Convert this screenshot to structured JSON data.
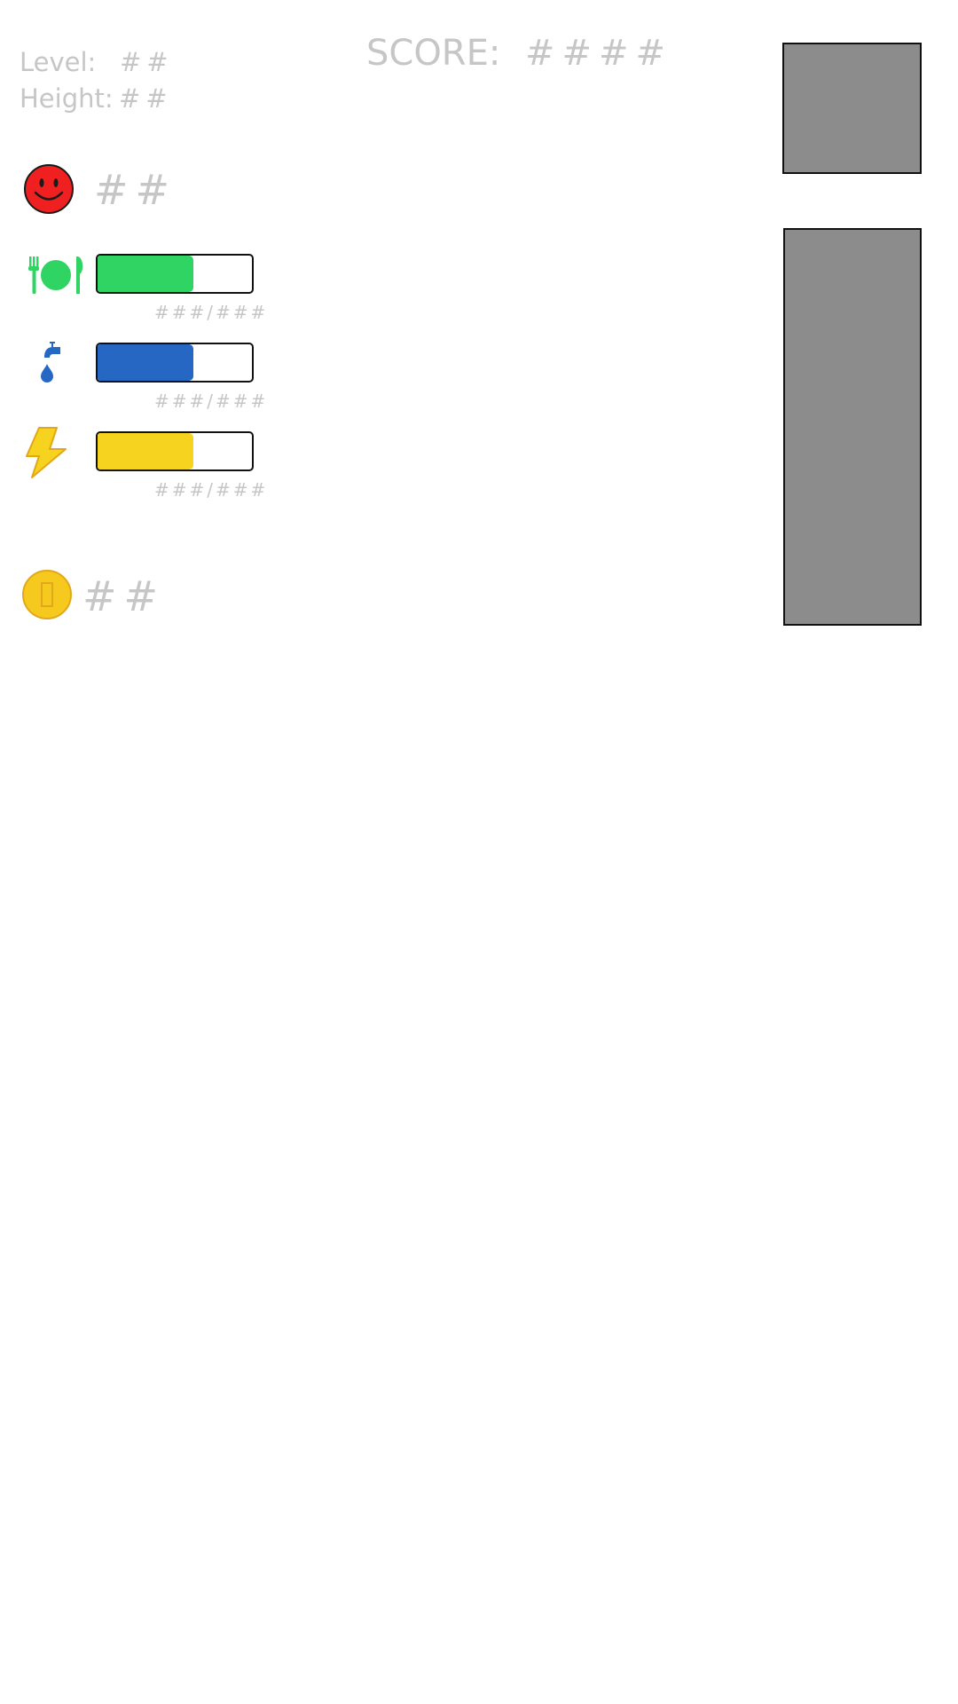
{
  "hud": {
    "level_label": "Level:",
    "level_value": "##",
    "height_label": "Height:",
    "height_value": "##",
    "score_label": "SCORE:",
    "score_value": "####",
    "mood_value": "##",
    "coins_value": "##"
  },
  "stats": [
    {
      "name": "food",
      "icon": "plate-fork-knife-icon",
      "color": "#2fd463",
      "fill_fraction": 0.62,
      "text": "###/###"
    },
    {
      "name": "water",
      "icon": "water-tap-drop-icon",
      "color": "#2667c4",
      "fill_fraction": 0.62,
      "text": "###/###"
    },
    {
      "name": "energy",
      "icon": "lightning-bolt-icon",
      "color": "#f6d31e",
      "fill_fraction": 0.62,
      "text": "###/###"
    }
  ],
  "icons": {
    "mood": "smiley-face-icon",
    "coin": "coin-icon"
  },
  "colors": {
    "text_gray": "#c6c6c6",
    "slot_gray": "#8c8c8c",
    "mood_red": "#f02020",
    "coin_gold": "#f6c91e"
  }
}
